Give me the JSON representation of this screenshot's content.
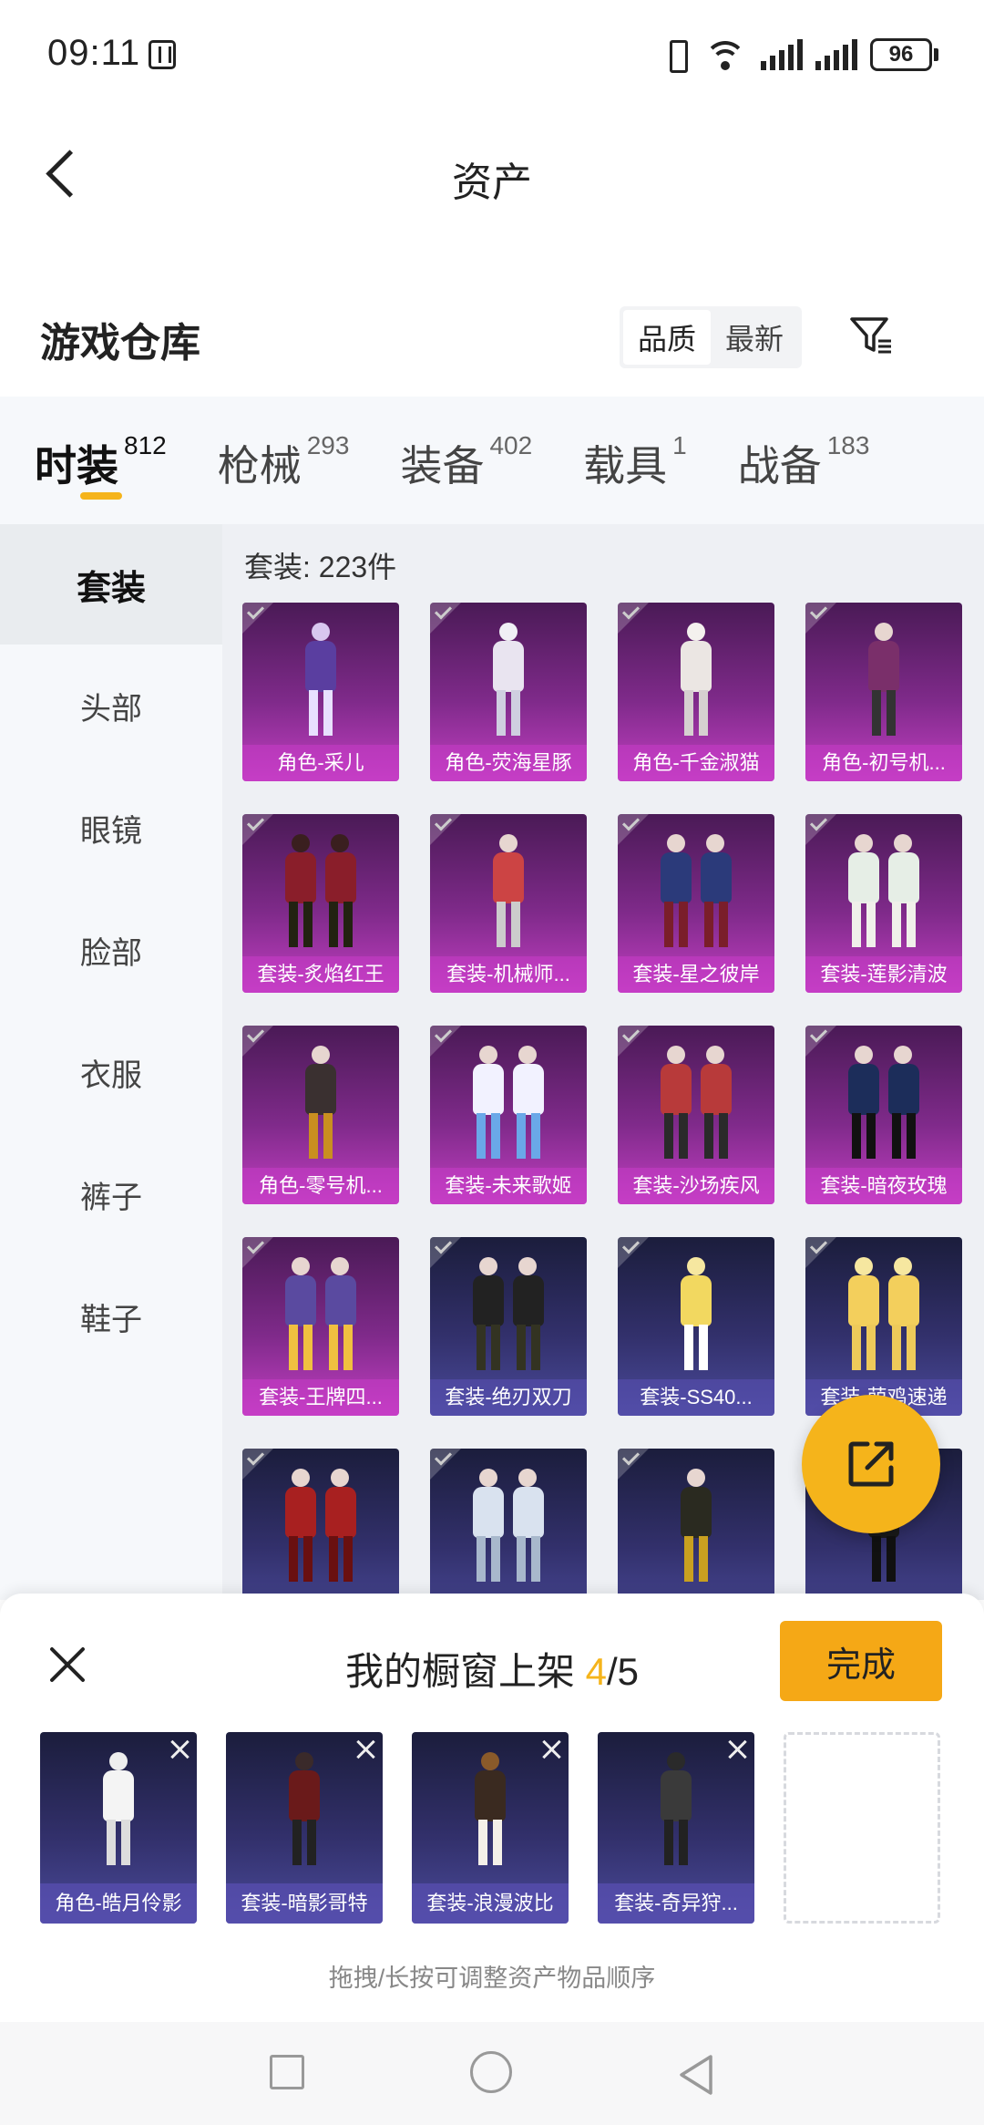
{
  "status_bar": {
    "time": "09:11",
    "battery": "96"
  },
  "header": {
    "title": "资产"
  },
  "section": {
    "title": "游戏仓库",
    "sort_options": [
      "品质",
      "最新"
    ]
  },
  "tabs": [
    {
      "label": "时装",
      "count": "812"
    },
    {
      "label": "枪械",
      "count": "293"
    },
    {
      "label": "装备",
      "count": "402"
    },
    {
      "label": "载具",
      "count": "1"
    },
    {
      "label": "战备",
      "count": "183"
    }
  ],
  "sidebar": {
    "items": [
      "套装",
      "头部",
      "眼镜",
      "脸部",
      "衣服",
      "裤子",
      "鞋子"
    ]
  },
  "grid": {
    "count_text": "套装: 223件",
    "items": [
      {
        "label": "角色-采儿",
        "bg": "purple"
      },
      {
        "label": "角色-荧海星豚",
        "bg": "purple"
      },
      {
        "label": "角色-千金淑猫",
        "bg": "purple"
      },
      {
        "label": "角色-初号机...",
        "bg": "purple"
      },
      {
        "label": "套装-炙焰红王",
        "bg": "purple"
      },
      {
        "label": "套装-机械师...",
        "bg": "purple"
      },
      {
        "label": "套装-星之彼岸",
        "bg": "purple"
      },
      {
        "label": "套装-莲影清波",
        "bg": "purple"
      },
      {
        "label": "角色-零号机...",
        "bg": "purple"
      },
      {
        "label": "套装-未来歌姬",
        "bg": "purple"
      },
      {
        "label": "套装-沙场疾风",
        "bg": "purple"
      },
      {
        "label": "套装-暗夜玫瑰",
        "bg": "purple"
      },
      {
        "label": "套装-王牌四...",
        "bg": "purple"
      },
      {
        "label": "套装-绝刃双刀",
        "bg": "blue"
      },
      {
        "label": "套装-SS40...",
        "bg": "blue"
      },
      {
        "label": "套装-萌鸡速递",
        "bg": "blue"
      },
      {
        "label": "",
        "bg": "blue"
      },
      {
        "label": "",
        "bg": "blue"
      },
      {
        "label": "",
        "bg": "blue"
      },
      {
        "label": "",
        "bg": "blue"
      }
    ]
  },
  "sheet": {
    "title_prefix": "我的橱窗上架 ",
    "current": "4",
    "total_suffix": "/5",
    "done_label": "完成",
    "shelf_items": [
      "角色-皓月伶影",
      "套装-暗影哥特",
      "套装-浪漫波比",
      "套装-奇异狩..."
    ],
    "hint": "拖拽/长按可调整资产物品顺序"
  },
  "colors": {
    "accent": "#f5b41b",
    "done_button": "#f5a816",
    "card_purple": "#7f2a8a",
    "card_blue": "#32306b"
  }
}
